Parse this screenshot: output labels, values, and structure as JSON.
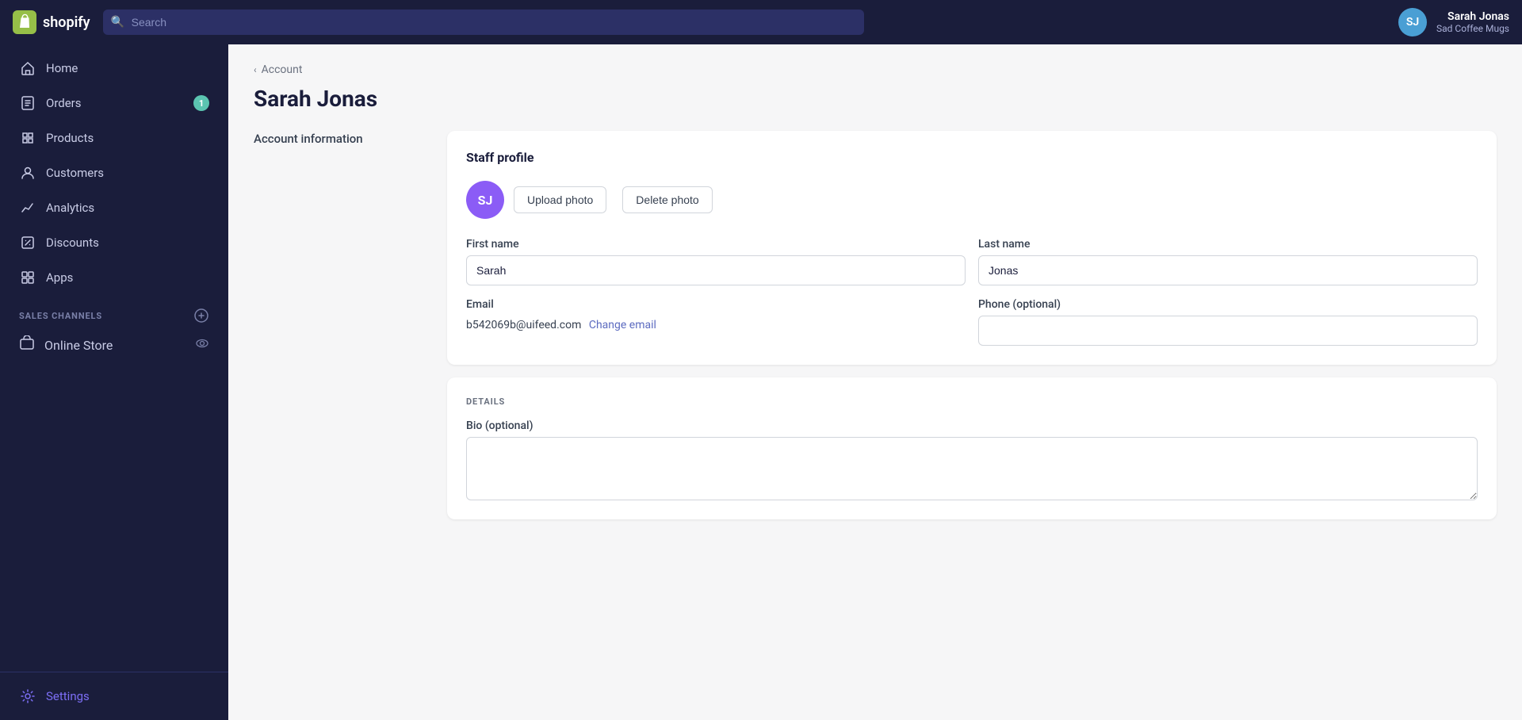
{
  "topnav": {
    "logo_text": "shopify",
    "search_placeholder": "Search",
    "user_name": "Sarah Jonas",
    "user_store": "Sad Coffee Mugs",
    "user_initials": "SJ"
  },
  "sidebar": {
    "items": [
      {
        "id": "home",
        "label": "Home",
        "icon": "home-icon",
        "badge": null
      },
      {
        "id": "orders",
        "label": "Orders",
        "icon": "orders-icon",
        "badge": "1"
      },
      {
        "id": "products",
        "label": "Products",
        "icon": "products-icon",
        "badge": null
      },
      {
        "id": "customers",
        "label": "Customers",
        "icon": "customers-icon",
        "badge": null
      },
      {
        "id": "analytics",
        "label": "Analytics",
        "icon": "analytics-icon",
        "badge": null
      },
      {
        "id": "discounts",
        "label": "Discounts",
        "icon": "discounts-icon",
        "badge": null
      },
      {
        "id": "apps",
        "label": "Apps",
        "icon": "apps-icon",
        "badge": null
      }
    ],
    "sales_channels_title": "SALES CHANNELS",
    "sales_channels": [
      {
        "id": "online-store",
        "label": "Online Store"
      }
    ],
    "settings_label": "Settings"
  },
  "breadcrumb": {
    "back_label": "Account"
  },
  "page": {
    "title": "Sarah Jonas",
    "account_info_label": "Account information"
  },
  "staff_profile_card": {
    "title": "Staff profile",
    "avatar_initials": "SJ",
    "upload_photo_label": "Upload photo",
    "delete_photo_label": "Delete photo",
    "first_name_label": "First name",
    "first_name_value": "Sarah",
    "last_name_label": "Last name",
    "last_name_value": "Jonas",
    "email_label": "Email",
    "email_value": "b542069b@uifeed.com",
    "change_email_label": "Change email",
    "phone_label": "Phone (optional)",
    "phone_value": ""
  },
  "details_card": {
    "title": "DETAILS",
    "bio_label": "Bio (optional)",
    "bio_value": ""
  }
}
